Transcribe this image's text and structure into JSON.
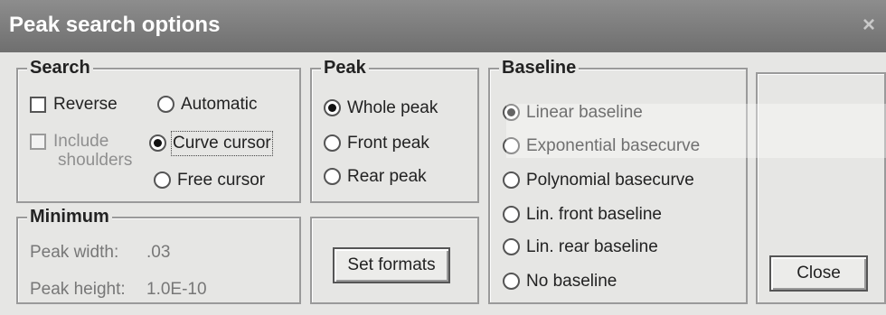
{
  "window": {
    "title": "Peak search options",
    "close_glyph": "×"
  },
  "search": {
    "legend": "Search",
    "reverse_label": "Reverse",
    "reverse_checked": false,
    "include_shoulders_label_line1": "Include",
    "include_shoulders_label_line2": "shoulders",
    "include_shoulders_enabled": false,
    "mode_options": [
      "Automatic",
      "Curve cursor",
      "Free cursor"
    ],
    "mode_selected": "Curve cursor"
  },
  "peak": {
    "legend": "Peak",
    "options": [
      "Whole peak",
      "Front peak",
      "Rear peak"
    ],
    "selected": "Whole peak"
  },
  "baseline": {
    "legend": "Baseline",
    "options": [
      "Linear baseline",
      "Exponential basecurve",
      "Polynomial basecurve",
      "Lin. front baseline",
      "Lin. rear baseline",
      "No baseline"
    ],
    "selected": "Linear baseline"
  },
  "minimum": {
    "legend": "Minimum",
    "peak_width_label": "Peak width:",
    "peak_width_value": ".03",
    "peak_height_label": "Peak height:",
    "peak_height_value": "1.0E-10"
  },
  "buttons": {
    "set_formats": "Set formats",
    "close": "Close"
  }
}
